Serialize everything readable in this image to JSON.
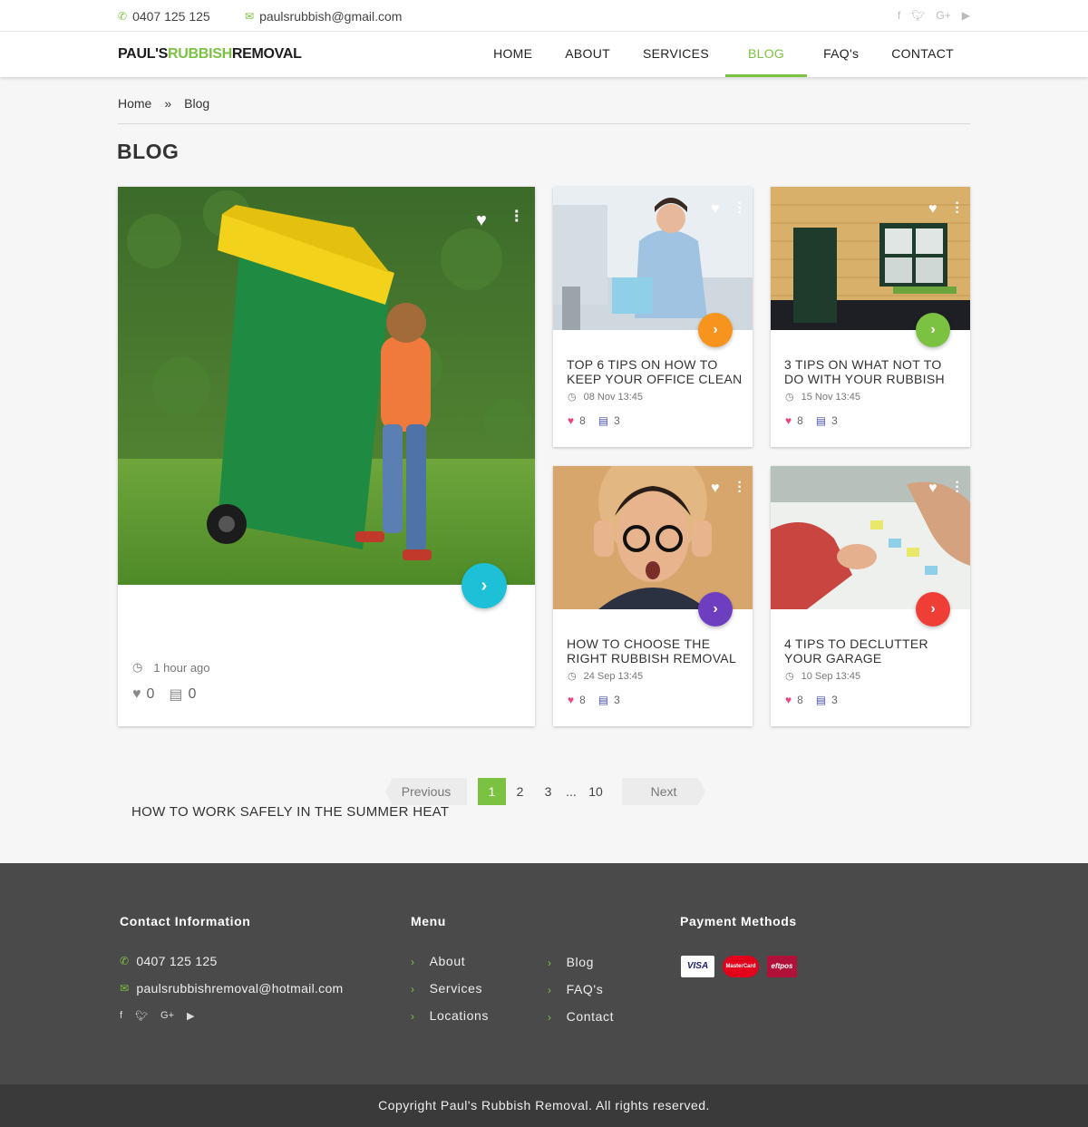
{
  "topbar": {
    "phone": "0407 125 125",
    "email": "paulsrubbish@gmail.com",
    "social": [
      "facebook-icon",
      "twitter-icon",
      "google-plus-icon",
      "youtube-icon"
    ]
  },
  "logo": {
    "part1": "PAUL'S",
    "part2": "RUBBISH",
    "part3": "REMOVAL"
  },
  "nav": {
    "items": [
      "HOME",
      "ABOUT",
      "SERVICES",
      "BLOG",
      "FAQ's",
      "CONTACT"
    ],
    "active": "BLOG"
  },
  "breadcrumb": {
    "home": "Home",
    "sep": "»",
    "current": "Blog"
  },
  "page_title": "BLOG",
  "featured": {
    "title": "HOW TO WORK SAFELY IN THE SUMMER HEAT",
    "time": "1 hour ago",
    "likes": "0",
    "comments": "0",
    "accent": "#1ec0d8"
  },
  "posts": [
    {
      "title": "TOP 6 TIPS ON HOW TO KEEP YOUR OFFICE CLEAN",
      "date": "08 Nov 13:45",
      "likes": "8",
      "comments": "3",
      "accent": "#f7941d"
    },
    {
      "title": "3 TIPS ON WHAT NOT TO DO WITH YOUR RUBBISH",
      "date": "15 Nov 13:45",
      "likes": "8",
      "comments": "3",
      "accent": "#7cc242"
    },
    {
      "title": "HOW TO CHOOSE THE RIGHT RUBBISH REMOVAL",
      "date": "24 Sep 13:45",
      "likes": "8",
      "comments": "3",
      "accent": "#6d3fc0"
    },
    {
      "title": "4 TIPS TO DECLUTTER YOUR GARAGE",
      "date": "10 Sep 13:45",
      "likes": "8",
      "comments": "3",
      "accent": "#ef3e36"
    }
  ],
  "pagination": {
    "prev": "Previous",
    "pages": [
      "1",
      "2",
      "3"
    ],
    "ellipsis": "...",
    "last": "10",
    "next": "Next",
    "current": "1"
  },
  "footer": {
    "contact_heading": "Contact Information",
    "phone": "0407 125 125",
    "email": "paulsrubbishremoval@hotmail.com",
    "menu_heading": "Menu",
    "menu_col1": [
      "About",
      "Services",
      "Locations"
    ],
    "menu_col2": [
      "Blog",
      "FAQ's",
      "Contact"
    ],
    "payment_heading": "Payment Methods",
    "payments": [
      "VISA",
      "MasterCard",
      "eftpos"
    ]
  },
  "copyright": "Copyright Paul's Rubbish Removal. All rights reserved.",
  "colors": {
    "brand_green": "#7cc242",
    "footer_bg": "#4a4a4a",
    "copyright_bg": "#3a3a3a"
  }
}
